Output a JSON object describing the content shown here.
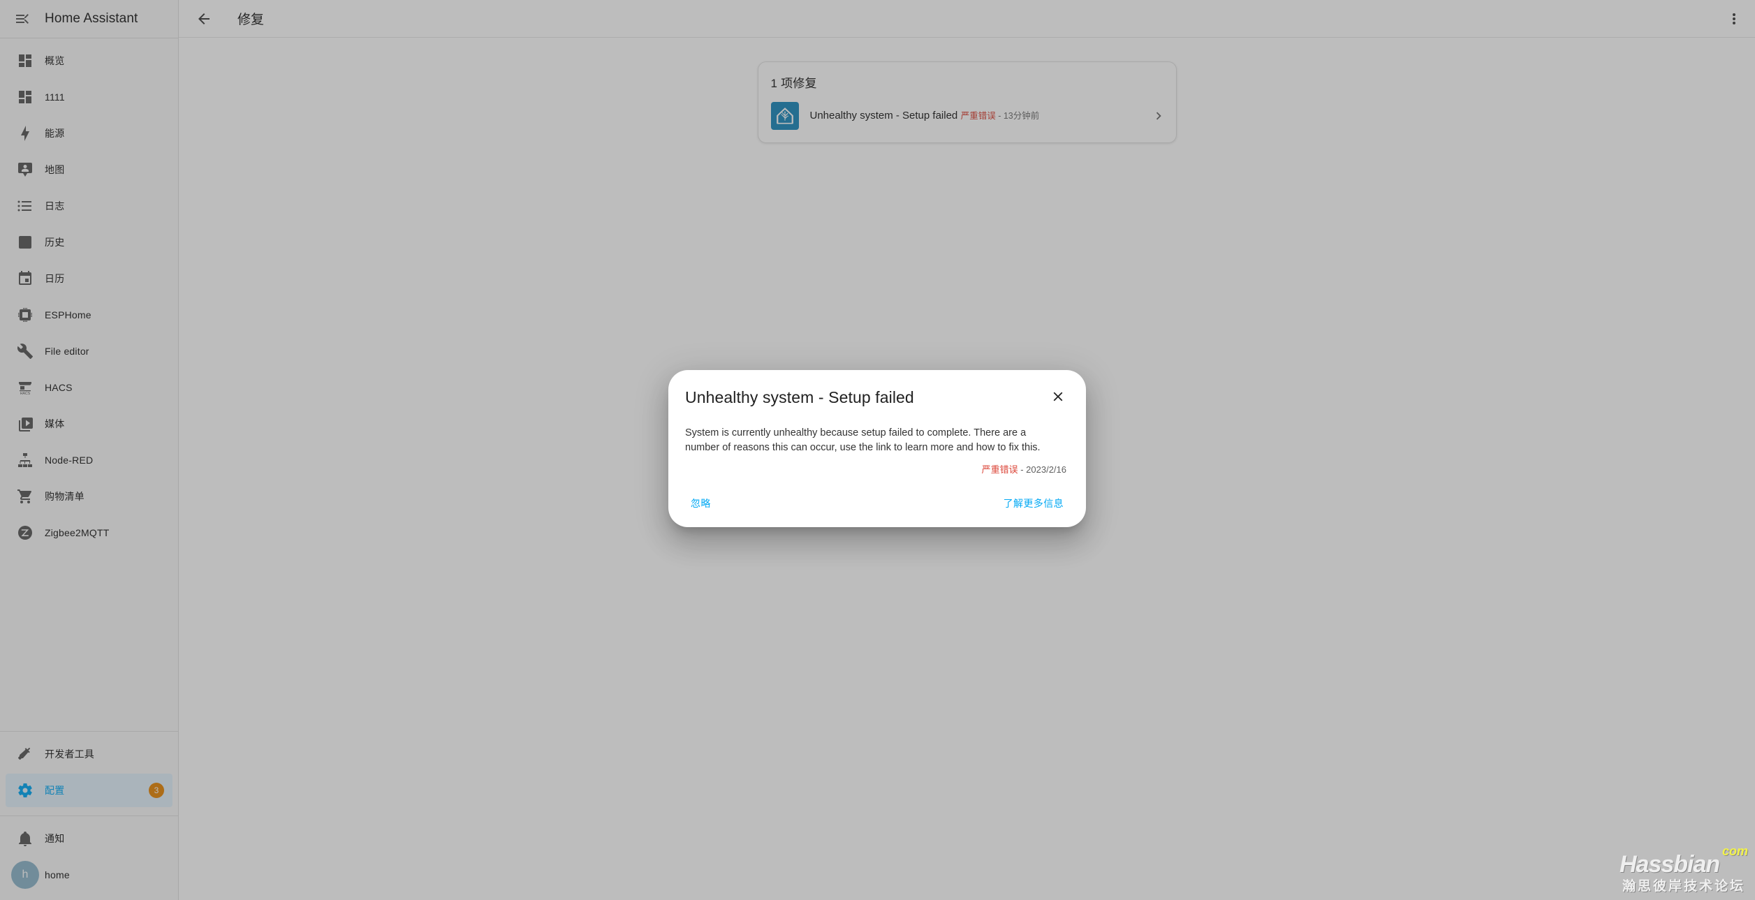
{
  "sidebar": {
    "title": "Home Assistant",
    "menu_icon": "menu-open-icon",
    "items": [
      {
        "label": "概览",
        "icon": "view-dashboard-icon",
        "active": false,
        "badge": ""
      },
      {
        "label": "1111",
        "icon": "view-dashboard-icon",
        "active": false,
        "badge": ""
      },
      {
        "label": "能源",
        "icon": "lightning-bolt-icon",
        "active": false,
        "badge": ""
      },
      {
        "label": "地图",
        "icon": "map-marker-account-icon",
        "active": false,
        "badge": ""
      },
      {
        "label": "日志",
        "icon": "format-list-bulleted-icon",
        "active": false,
        "badge": ""
      },
      {
        "label": "历史",
        "icon": "chart-box-icon",
        "active": false,
        "badge": ""
      },
      {
        "label": "日历",
        "icon": "calendar-icon",
        "active": false,
        "badge": ""
      },
      {
        "label": "ESPHome",
        "icon": "chip-icon",
        "active": false,
        "badge": ""
      },
      {
        "label": "File editor",
        "icon": "wrench-icon",
        "active": false,
        "badge": ""
      },
      {
        "label": "HACS",
        "icon": "hacs-storefront-icon",
        "active": false,
        "badge": ""
      },
      {
        "label": "媒体",
        "icon": "play-box-multiple-icon",
        "active": false,
        "badge": ""
      },
      {
        "label": "Node-RED",
        "icon": "sitemap-icon",
        "active": false,
        "badge": ""
      },
      {
        "label": "购物清单",
        "icon": "cart-icon",
        "active": false,
        "badge": ""
      },
      {
        "label": "Zigbee2MQTT",
        "icon": "zigbee-icon",
        "active": false,
        "badge": ""
      }
    ],
    "bottom_items": [
      {
        "label": "开发者工具",
        "icon": "hammer-icon",
        "active": false,
        "badge": ""
      },
      {
        "label": "配置",
        "icon": "cog-icon",
        "active": true,
        "badge": "3"
      }
    ],
    "footer_items": [
      {
        "label": "通知",
        "icon": "bell-icon"
      }
    ],
    "user": {
      "name": "home",
      "avatar_initial": "h"
    }
  },
  "toolbar": {
    "back_icon": "arrow-left-icon",
    "title": "修复",
    "overflow_icon": "dots-vertical-icon"
  },
  "repairs_card": {
    "title": "1 项修复",
    "items": [
      {
        "icon": "home-assistant-logo-icon",
        "primary": "Unhealthy system - Setup failed",
        "severity": "严重错误",
        "separator": " - ",
        "time": "13分钟前",
        "chevron_icon": "chevron-right-icon"
      }
    ]
  },
  "dialog": {
    "title": "Unhealthy system - Setup failed",
    "close_icon": "close-icon",
    "body": "System is currently unhealthy because setup failed to complete. There are a number of reasons this can occur, use the link to learn more and how to fix this.",
    "severity": "严重错误",
    "separator": " - ",
    "date": "2023/2/16",
    "ignore_label": "忽略",
    "learn_more_label": "了解更多信息"
  },
  "watermark": {
    "main": "Hassbian",
    "tld": "com",
    "subtitle": "瀚思彼岸技术论坛"
  },
  "colors": {
    "accent": "#03a9f4",
    "critical": "#db4437",
    "badge": "#e8890c",
    "ha_logo_bg": "#1f8bbd"
  }
}
